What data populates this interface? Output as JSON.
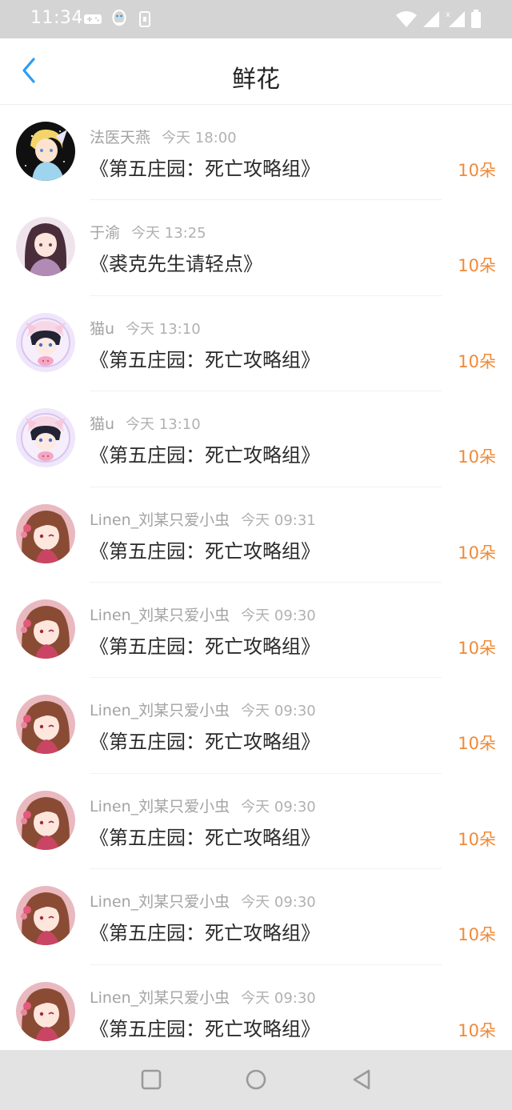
{
  "status_bar": {
    "time": "11:34"
  },
  "header": {
    "title": "鲜花"
  },
  "colors": {
    "accent": "#2e9cf0",
    "count": "#f08a38"
  },
  "items": [
    {
      "name": "法医天燕",
      "time": "今天 18:00",
      "book": "《第五庄园：死亡攻略组》",
      "count": "10朵",
      "avatar": "blonde-anime-avatar"
    },
    {
      "name": "于渝",
      "time": "今天 13:25",
      "book": "《裘克先生请轻点》",
      "count": "10朵",
      "avatar": "purple-hair-girl-avatar"
    },
    {
      "name": "猫u",
      "time": "今天 13:10",
      "book": "《第五庄园：死亡攻略组》",
      "count": "10朵",
      "avatar": "pig-hood-avatar"
    },
    {
      "name": "猫u",
      "time": "今天 13:10",
      "book": "《第五庄园：死亡攻略组》",
      "count": "10朵",
      "avatar": "pig-hood-avatar"
    },
    {
      "name": "Linen_刘某只爱小虫",
      "time": "今天 09:31",
      "book": "《第五庄园：死亡攻略组》",
      "count": "10朵",
      "avatar": "brown-hair-girl-avatar"
    },
    {
      "name": "Linen_刘某只爱小虫",
      "time": "今天 09:30",
      "book": "《第五庄园：死亡攻略组》",
      "count": "10朵",
      "avatar": "brown-hair-girl-avatar"
    },
    {
      "name": "Linen_刘某只爱小虫",
      "time": "今天 09:30",
      "book": "《第五庄园：死亡攻略组》",
      "count": "10朵",
      "avatar": "brown-hair-girl-avatar"
    },
    {
      "name": "Linen_刘某只爱小虫",
      "time": "今天 09:30",
      "book": "《第五庄园：死亡攻略组》",
      "count": "10朵",
      "avatar": "brown-hair-girl-avatar"
    },
    {
      "name": "Linen_刘某只爱小虫",
      "time": "今天 09:30",
      "book": "《第五庄园：死亡攻略组》",
      "count": "10朵",
      "avatar": "brown-hair-girl-avatar"
    },
    {
      "name": "Linen_刘某只爱小虫",
      "time": "今天 09:30",
      "book": "《第五庄园：死亡攻略组》",
      "count": "10朵",
      "avatar": "brown-hair-girl-avatar"
    }
  ],
  "nav": {
    "recents": "recents-square-icon",
    "home": "home-circle-icon",
    "back": "back-triangle-icon"
  }
}
